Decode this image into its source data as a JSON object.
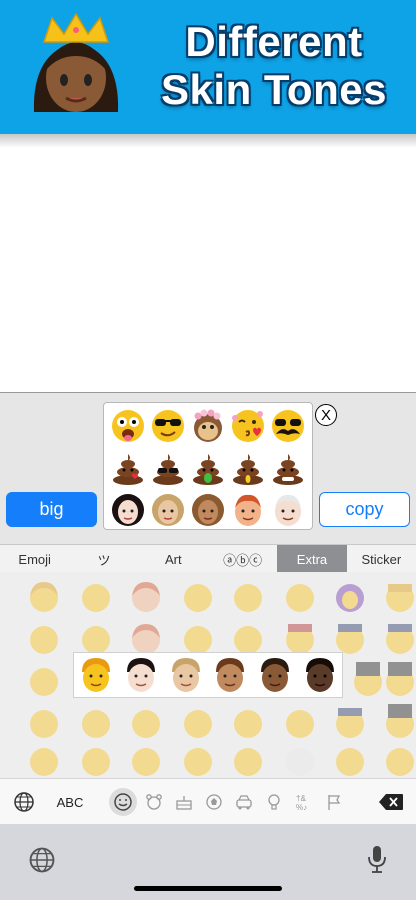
{
  "banner": {
    "title_line1": "Different",
    "title_line2": "Skin Tones",
    "icon": "queen-emoji-icon"
  },
  "preview": {
    "emojis": [
      "cheeky-face-icon",
      "sunglasses-face-icon",
      "flower-monkey-icon",
      "kissing-face-icon",
      "mustache-face-icon",
      "poop-heart-icon",
      "poop-sunglasses-icon",
      "poop-tongue-icon",
      "poop-yellow-icon",
      "poop-grin-icon",
      "curly-girl-icon",
      "curly-blonde-girl-icon",
      "curly-brown-girl-icon",
      "red-hair-man-icon",
      "white-hair-man-icon"
    ],
    "close_label": "X"
  },
  "buttons": {
    "big_label": "big",
    "copy_label": "copy"
  },
  "tabs": [
    {
      "label": "Emoji",
      "active": false
    },
    {
      "label": "ツ",
      "active": false
    },
    {
      "label": "Art",
      "active": false
    },
    {
      "label": "ⓐⓑⓒ",
      "active": false
    },
    {
      "label": "Extra",
      "active": true
    },
    {
      "label": "Sticker",
      "active": false
    }
  ],
  "skin_tones": [
    "yellow",
    "light",
    "medium-light",
    "medium",
    "medium-dark",
    "dark"
  ],
  "keyboard": {
    "abc_label": "ABC",
    "icons": [
      "globe-icon",
      "smiley-icon",
      "bear-icon",
      "cake-icon",
      "ball-icon",
      "car-icon",
      "bulb-icon",
      "symbols-icon",
      "flag-icon",
      "delete-icon"
    ]
  },
  "colors": {
    "brand": "#0ea2e6",
    "accent": "#147efb"
  }
}
